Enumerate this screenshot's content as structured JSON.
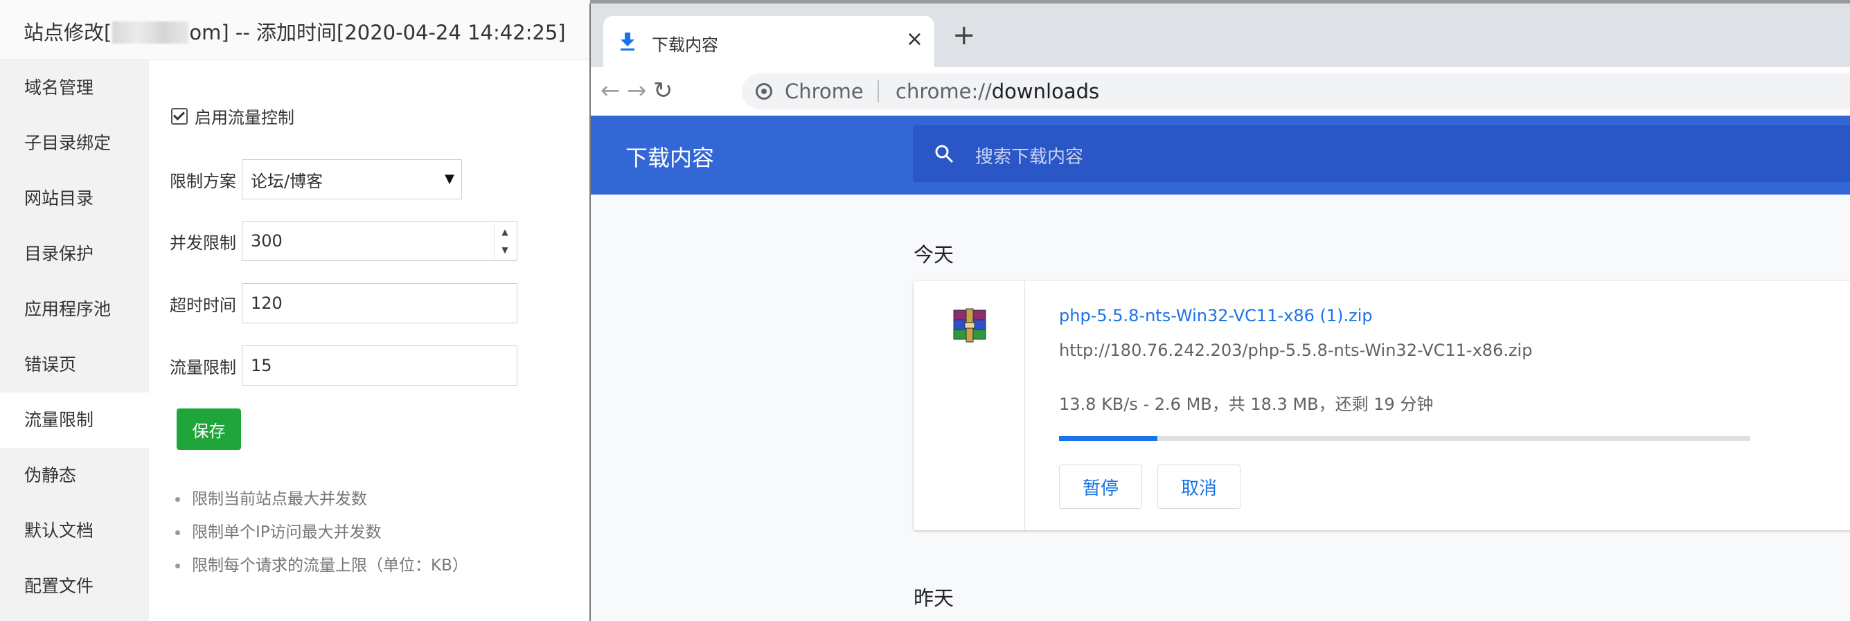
{
  "dialog": {
    "title_prefix": "站点修改[",
    "title_suffix": "om] -- 添加时间[2020-04-24 14:42:25]"
  },
  "menu": [
    {
      "label": "域名管理"
    },
    {
      "label": "子目录绑定"
    },
    {
      "label": "网站目录"
    },
    {
      "label": "目录保护"
    },
    {
      "label": "应用程序池"
    },
    {
      "label": "错误页"
    },
    {
      "label": "流量限制",
      "active": true
    },
    {
      "label": "伪静态"
    },
    {
      "label": "默认文档"
    },
    {
      "label": "配置文件"
    }
  ],
  "form": {
    "enable_label": "启用流量控制",
    "enable_checked": true,
    "plan_label": "限制方案",
    "plan_value": "论坛/博客",
    "concurrency_label": "并发限制",
    "concurrency_value": "300",
    "timeout_label": "超时时间",
    "timeout_value": "120",
    "traffic_label": "流量限制",
    "traffic_value": "15",
    "save_label": "保存",
    "tips": [
      "限制当前站点最大并发数",
      "限制单个IP访问最大并发数",
      "限制每个请求的流量上限（单位：KB）"
    ]
  },
  "browser": {
    "tab_title": "下载内容",
    "tab_close": "×",
    "new_tab": "+",
    "omnibox_chip": "Chrome",
    "omnibox_scheme": "chrome://",
    "omnibox_host": "downloads",
    "nav_icons": [
      "arrow-left-icon",
      "arrow-right-icon",
      "reload-icon"
    ]
  },
  "downloads": {
    "page_title": "下载内容",
    "search_placeholder": "搜索下载内容",
    "today_label": "今天",
    "yesterday_label": "昨天",
    "item": {
      "file_name": "php-5.5.8-nts-Win32-VC11-x86 (1).zip",
      "url": "http://180.76.242.203/php-5.5.8-nts-Win32-VC11-x86.zip",
      "status": "13.8 KB/s - 2.6 MB，共 18.3 MB，还剩 19 分钟",
      "progress_fraction": 0.142,
      "pause_label": "暂停",
      "cancel_label": "取消"
    }
  },
  "colors": {
    "accent_green": "#20a53a",
    "chrome_header": "#3367d6",
    "link_blue": "#1a73e8"
  }
}
